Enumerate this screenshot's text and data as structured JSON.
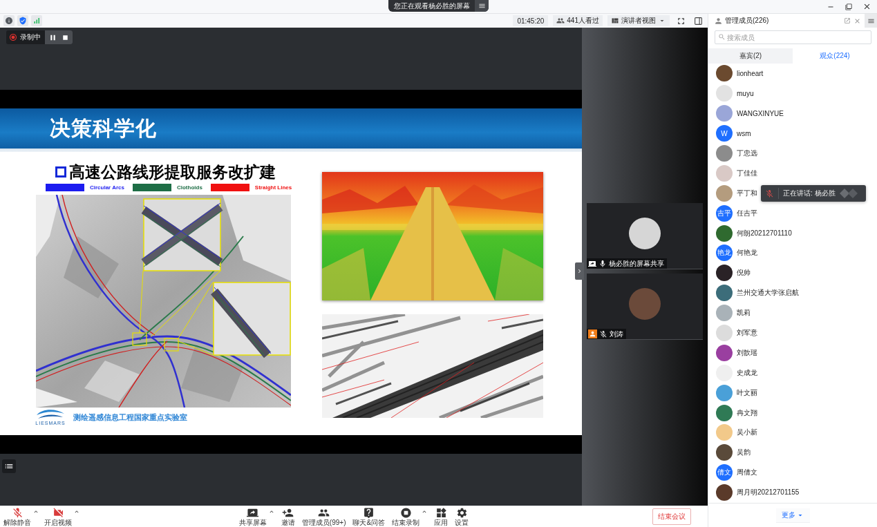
{
  "title_bar": {
    "banner": "您正在观看杨必胜的屏幕"
  },
  "meeting_bar": {
    "duration": "01:45:20",
    "viewers": "441人看过",
    "layout": "演讲者视图"
  },
  "recording": {
    "label": "录制中"
  },
  "slide": {
    "title": "决策科学化",
    "subtitle": "高速公路线形提取服务改扩建",
    "legend": [
      {
        "label": "Circular Arcs",
        "color": "#1c1cf0"
      },
      {
        "label": "Clothoids",
        "color": "#1e6e46"
      },
      {
        "label": "Straight Lines",
        "color": "#f01010"
      }
    ],
    "logo": "LIESMARS",
    "footer": "测绘遥感信息工程国家重点实验室"
  },
  "video_tiles": [
    {
      "kind": "screen_share",
      "name": "杨必胜的屏幕共享",
      "muted": false
    },
    {
      "kind": "host",
      "name": "刘涛",
      "muted": true
    }
  ],
  "members_panel": {
    "title": "管理成员(226)",
    "search": {
      "placeholder": "搜索成员"
    },
    "tabs": [
      {
        "label": "嘉宾(2)",
        "selected": false
      },
      {
        "label": "观众(224)",
        "selected": true
      }
    ],
    "members": [
      {
        "kind": "photo",
        "name": "lionheart",
        "color": "#6b4a2f"
      },
      {
        "kind": "photo",
        "name": "muyu",
        "color": "#e2e2e2"
      },
      {
        "kind": "photo",
        "name": "WANGXINYUE",
        "color": "#9aa6d8"
      },
      {
        "kind": "initials",
        "avatar_text": "W",
        "name": "wsm",
        "color": "#1f6fff"
      },
      {
        "kind": "photo",
        "name": "丁忠选",
        "color": "#8c8c8c"
      },
      {
        "kind": "photo",
        "name": "丁佳佳",
        "color": "#d9c9c6"
      },
      {
        "kind": "photo",
        "name": "平丁和",
        "color": "#b49c7e"
      },
      {
        "kind": "initials",
        "avatar_text": "吉平",
        "name": "任吉平",
        "color": "#1f6fff"
      },
      {
        "kind": "photo",
        "name": "何朗20212701110",
        "color": "#2f6a2f"
      },
      {
        "kind": "initials",
        "avatar_text": "艳龙",
        "name": "何艳龙",
        "color": "#1f6fff"
      },
      {
        "kind": "photo",
        "name": "倪帅",
        "color": "#2a2226"
      },
      {
        "kind": "photo",
        "name": "兰州交通大学张启航",
        "color": "#3c6d7a"
      },
      {
        "kind": "photo",
        "name": "凯莉",
        "color": "#a9b2b8"
      },
      {
        "kind": "photo",
        "name": "刘军意",
        "color": "#dcdcdc"
      },
      {
        "kind": "photo",
        "name": "刘歆瑶",
        "color": "#9a3fa0"
      },
      {
        "kind": "photo",
        "name": "史成龙",
        "color": "#efefef"
      },
      {
        "kind": "photo",
        "name": "叶文丽",
        "color": "#4aa0d8"
      },
      {
        "kind": "photo",
        "name": "冉文翔",
        "color": "#2f7a55"
      },
      {
        "kind": "photo",
        "name": "吴小新",
        "color": "#f2c98a"
      },
      {
        "kind": "photo",
        "name": "吴韵",
        "color": "#5a4a3a"
      },
      {
        "kind": "initials",
        "avatar_text": "倩文",
        "name": "周倩文",
        "color": "#1f6fff"
      },
      {
        "kind": "photo",
        "name": "周月明20212701155",
        "color": "#5a3a2a"
      }
    ],
    "more": "更多"
  },
  "speaking_toast": {
    "text": "正在讲话: 杨必胜",
    "muted": true
  },
  "toolbar": {
    "left": [
      {
        "kind": "mic_muted",
        "label": "解除静音",
        "has_menu": true
      },
      {
        "kind": "video_off",
        "label": "开启视频",
        "has_menu": true
      }
    ],
    "center": [
      {
        "kind": "share_screen",
        "label": "共享屏幕",
        "has_menu": true
      },
      {
        "kind": "invite",
        "label": "邀请",
        "has_menu": false
      },
      {
        "kind": "members",
        "label": "管理成员(99+)",
        "has_menu": false
      },
      {
        "kind": "chat",
        "label": "聊天&问答",
        "has_menu": false
      },
      {
        "kind": "recording",
        "label": "结束录制",
        "has_menu": true
      },
      {
        "kind": "apps",
        "label": "应用",
        "has_menu": false
      },
      {
        "kind": "settings",
        "label": "设置",
        "has_menu": false
      }
    ],
    "end_button": "结束会议"
  }
}
